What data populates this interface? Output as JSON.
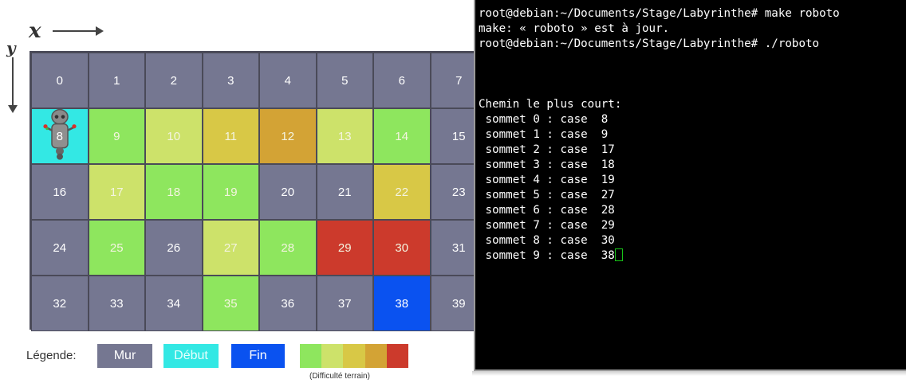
{
  "axis": {
    "x_label": "x",
    "y_label": "y"
  },
  "colors": {
    "wall": "#757791",
    "start": "#33e8e4",
    "end": "#0a52f0",
    "difficulty": [
      "#8ee65e",
      "#cde26a",
      "#d8c846",
      "#d3a335",
      "#cc3a2c"
    ]
  },
  "grid": {
    "rows": [
      [
        {
          "n": "0",
          "c": "wall"
        },
        {
          "n": "1",
          "c": "wall"
        },
        {
          "n": "2",
          "c": "wall"
        },
        {
          "n": "3",
          "c": "wall"
        },
        {
          "n": "4",
          "c": "wall"
        },
        {
          "n": "5",
          "c": "wall"
        },
        {
          "n": "6",
          "c": "wall"
        },
        {
          "n": "7",
          "c": "wall"
        }
      ],
      [
        {
          "n": "8",
          "c": "start",
          "robot": true
        },
        {
          "n": "9",
          "c": "d1"
        },
        {
          "n": "10",
          "c": "d2"
        },
        {
          "n": "11",
          "c": "d3"
        },
        {
          "n": "12",
          "c": "d4"
        },
        {
          "n": "13",
          "c": "d2"
        },
        {
          "n": "14",
          "c": "d1"
        },
        {
          "n": "15",
          "c": "wall"
        }
      ],
      [
        {
          "n": "16",
          "c": "wall"
        },
        {
          "n": "17",
          "c": "d2"
        },
        {
          "n": "18",
          "c": "d1"
        },
        {
          "n": "19",
          "c": "d1"
        },
        {
          "n": "20",
          "c": "wall"
        },
        {
          "n": "21",
          "c": "wall"
        },
        {
          "n": "22",
          "c": "d3"
        },
        {
          "n": "23",
          "c": "wall"
        }
      ],
      [
        {
          "n": "24",
          "c": "wall"
        },
        {
          "n": "25",
          "c": "d1"
        },
        {
          "n": "26",
          "c": "wall"
        },
        {
          "n": "27",
          "c": "d2"
        },
        {
          "n": "28",
          "c": "d1"
        },
        {
          "n": "29",
          "c": "d5"
        },
        {
          "n": "30",
          "c": "d5"
        },
        {
          "n": "31",
          "c": "wall"
        }
      ],
      [
        {
          "n": "32",
          "c": "wall"
        },
        {
          "n": "33",
          "c": "wall"
        },
        {
          "n": "34",
          "c": "wall"
        },
        {
          "n": "35",
          "c": "d1"
        },
        {
          "n": "36",
          "c": "wall"
        },
        {
          "n": "37",
          "c": "wall"
        },
        {
          "n": "38",
          "c": "end"
        },
        {
          "n": "39",
          "c": "wall"
        }
      ]
    ]
  },
  "legend": {
    "label": "Légende:",
    "wall": "Mur",
    "start": "Début",
    "end": "Fin",
    "difficulty_caption": "(Difficulté terrain)"
  },
  "terminal": {
    "lines": [
      "root@debian:~/Documents/Stage/Labyrinthe# make roboto",
      "make: « roboto » est à jour.",
      "root@debian:~/Documents/Stage/Labyrinthe# ./roboto",
      "",
      "",
      "",
      "Chemin le plus court:",
      " sommet 0 : case  8",
      " sommet 1 : case  9",
      " sommet 2 : case  17",
      " sommet 3 : case  18",
      " sommet 4 : case  19",
      " sommet 5 : case  27",
      " sommet 6 : case  28",
      " sommet 7 : case  29",
      " sommet 8 : case  30",
      " sommet 9 : case  38"
    ],
    "cursor_icon": "cursor-block-icon"
  }
}
